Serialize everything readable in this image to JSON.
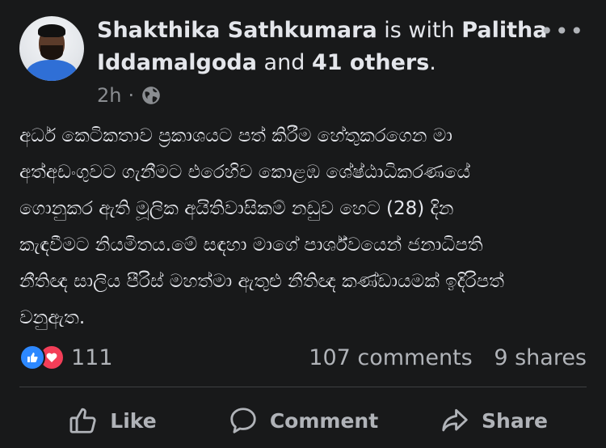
{
  "post": {
    "author": "Shakthika Sathkumara",
    "with_word": "is with",
    "tagged": "Palitha Iddamalgoda",
    "and_word": "and",
    "others": "41 others",
    "period": ".",
    "time": "2h",
    "separator": "·",
    "privacy_icon": "globe-icon",
    "more_icon": "more-options-icon",
    "text": "අර්ධ කෙටිකතාව ප්‍රකාශයට පත් කිරීම හේතුකරගෙන මා\nඅත්අඩංගුවට ගැනීමට එරෙහිව කොළඹ ශේෂ්ඨාධිකරණයේ\nගොනුකර ඇති මූලික අයිතිවාසිකම් නඩුව හෙට (28) දින\nකැඳවීමට නියමිතය.මේ සඳහා මාගේ පාර්ශ්වයෙන් ජනාධිපති\nනීතිඥ සාලිය පීරිස් මහත්මා ඇතුළු නීතිඥ කණ්ඩායමක් ඉදිරිපත්\nවනුඇත."
  },
  "stats": {
    "reaction_count": "111",
    "comments": "107 comments",
    "shares": "9 shares",
    "like_color": "#2d88ff",
    "love_color": "#f33e58"
  },
  "actions": {
    "like": "Like",
    "comment": "Comment",
    "share": "Share"
  }
}
